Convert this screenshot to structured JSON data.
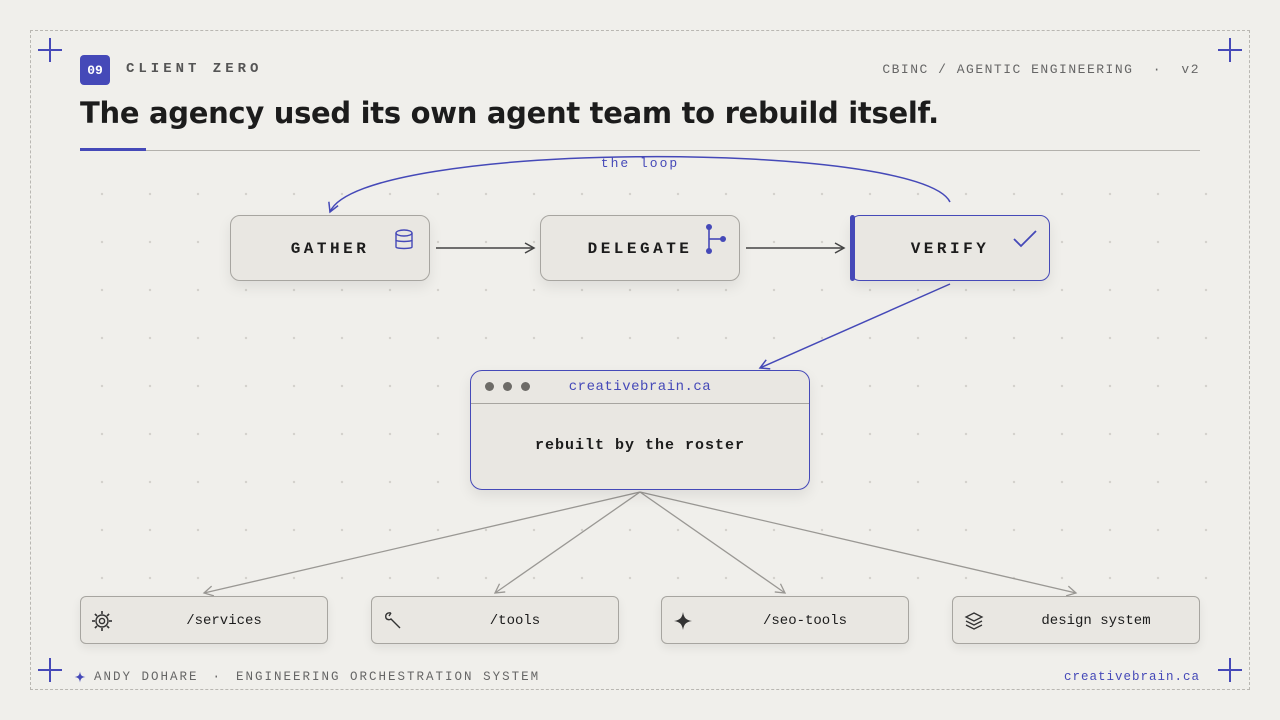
{
  "header": {
    "badge": "09",
    "kicker": "CLIENT ZERO",
    "context": "CBINC / AGENTIC ENGINEERING",
    "separator": "·",
    "version": "v2",
    "title": "The agency used its own agent team to rebuild itself."
  },
  "loop": {
    "label": "the loop",
    "steps": [
      {
        "label": "GATHER",
        "icon": "database-icon"
      },
      {
        "label": "DELEGATE",
        "icon": "branch-icon"
      },
      {
        "label": "VERIFY",
        "icon": "check-icon"
      }
    ]
  },
  "site": {
    "url": "creativebrain.ca",
    "caption": "rebuilt by the roster"
  },
  "outputs": [
    {
      "label": "/services",
      "icon": "gear-icon"
    },
    {
      "label": "/tools",
      "icon": "wrench-icon"
    },
    {
      "label": "/seo-tools",
      "icon": "sparkle-icon"
    },
    {
      "label": "design system",
      "icon": "layers-icon"
    }
  ],
  "footer": {
    "author": "ANDY DOHARE",
    "separator": "·",
    "system": "ENGINEERING ORCHESTRATION SYSTEM",
    "site": "creativebrain.ca"
  },
  "colors": {
    "accent": "#4549b8",
    "background": "#f0efeb",
    "card": "#e9e7e2"
  }
}
